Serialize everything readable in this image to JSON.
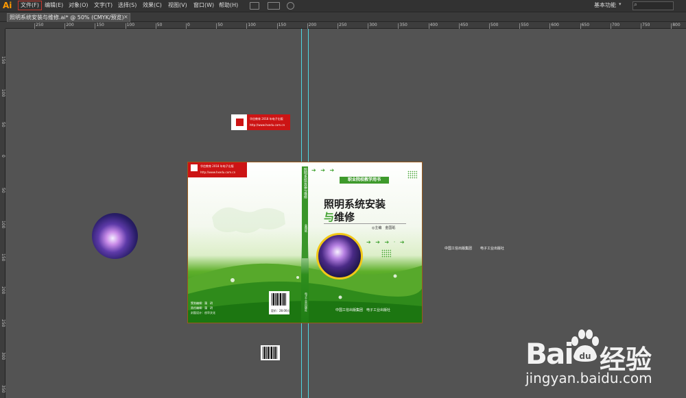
{
  "app": {
    "logo": "Ai",
    "menu": [
      "文件(F)",
      "编辑(E)",
      "对象(O)",
      "文字(T)",
      "选择(S)",
      "效果(C)",
      "视图(V)",
      "窗口(W)",
      "帮助(H)"
    ],
    "workspace": "基本功能",
    "workspace_caret": "▾",
    "search_icon": "⌕"
  },
  "document_tab": {
    "label": "照明系统安装与维修.ai* @ 50% (CMYK/预览)",
    "close": "×"
  },
  "rulers": {
    "top_ticks": [
      "250",
      "200",
      "150",
      "100",
      "50",
      "0",
      "50",
      "100",
      "150",
      "200",
      "250",
      "300",
      "350",
      "400",
      "450",
      "500",
      "550",
      "600",
      "650",
      "700",
      "750",
      "800"
    ],
    "left_ticks": [
      "150",
      "100",
      "50",
      "0",
      "50",
      "100",
      "150",
      "200",
      "250",
      "300",
      "350"
    ]
  },
  "cover": {
    "series": "职业院校教学用书",
    "title_line1": "照明系统安装",
    "title_line2_a": "与",
    "title_line2_b": "维修",
    "author": "◎主编　金国砥",
    "spine_title": "照明系统安装与维修",
    "spine_author": "金国砥",
    "spine_publisher": "电子工业出版社",
    "front_publishers": "中国工信出版集团　电子工业出版社",
    "back_logo_line1": "华信教育 2018 年电子出版",
    "back_logo_line2": "http://www.hxedu.com.cn",
    "price": "定价：28.00元",
    "credits": [
      "策划编辑：蒲　玥",
      "责任编辑：蒲　玥",
      "封面设计：创华文化"
    ],
    "arrows_top": "➔ ➔ ➔",
    "arrows_mid": "➔ ➔ ➔ · ➔"
  },
  "pasteboard": {
    "logo_line1": "华信教育 2018 年电子出版",
    "logo_line2": "http://www.hxedu.com.cn",
    "publisher_a": "中国工信出版集团",
    "publisher_b": "电子工业出版社"
  },
  "watermark": {
    "bai": "Bai",
    "du": "经验",
    "url": "jingyan.baidu.com"
  },
  "colors": {
    "accent_green": "#3fa12e",
    "brand_red": "#cc1414",
    "guide_cyan": "#4fd8e4",
    "ai_orange": "#ff9a00"
  }
}
